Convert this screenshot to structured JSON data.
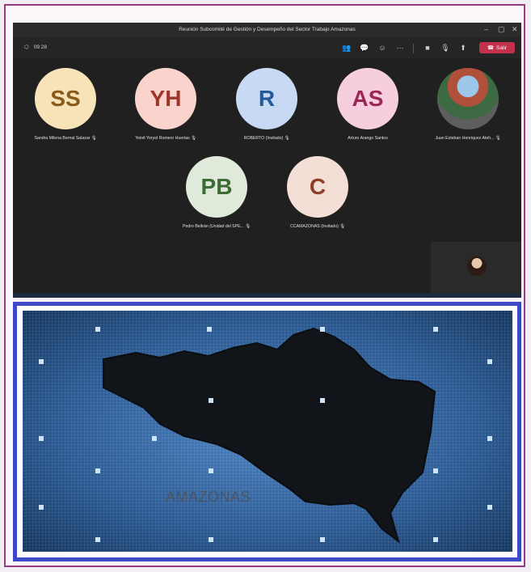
{
  "window": {
    "title": "Reunión Subcomité de Gestión y Desempeño del Sector Trabajo Amazonas",
    "minimize_icon": "minimize-icon",
    "maximize_icon": "maximize-icon",
    "close_icon": "close-icon"
  },
  "toolbar": {
    "timer": "09:28",
    "leave_label": "Salir",
    "leave_color": "#c4314b"
  },
  "participants": [
    {
      "initials": "SS",
      "name": "Sandra Milena Bernal Salazar",
      "bg": "#f6e3b8",
      "fg": "#8a5a1b",
      "muted": true
    },
    {
      "initials": "YH",
      "name": "Yeinit Yoryel Romero Huertas",
      "bg": "#f9d3cc",
      "fg": "#9e3526",
      "muted": true
    },
    {
      "initials": "R",
      "name": "ROBERTO (Invitado)",
      "bg": "#c8daf3",
      "fg": "#245a98",
      "muted": true
    },
    {
      "initials": "AS",
      "name": "Arturo Arango Santos",
      "bg": "#f6cede",
      "fg": "#9c2757",
      "muted": false
    },
    {
      "initials": "",
      "name": "Juan Esteban Henriquez Ateh...",
      "bg": "",
      "fg": "",
      "muted": true
    },
    {
      "initials": "PB",
      "name": "Pedro Beltrán (Unidad del SPE...",
      "bg": "#dfeadb",
      "fg": "#3d6b36",
      "muted": true
    },
    {
      "initials": "C",
      "name": "CCAMAZONAS (Invitado)",
      "bg": "#f3dfd5",
      "fg": "#8e4027",
      "muted": true
    }
  ],
  "map": {
    "label": "AMAZONAS"
  }
}
